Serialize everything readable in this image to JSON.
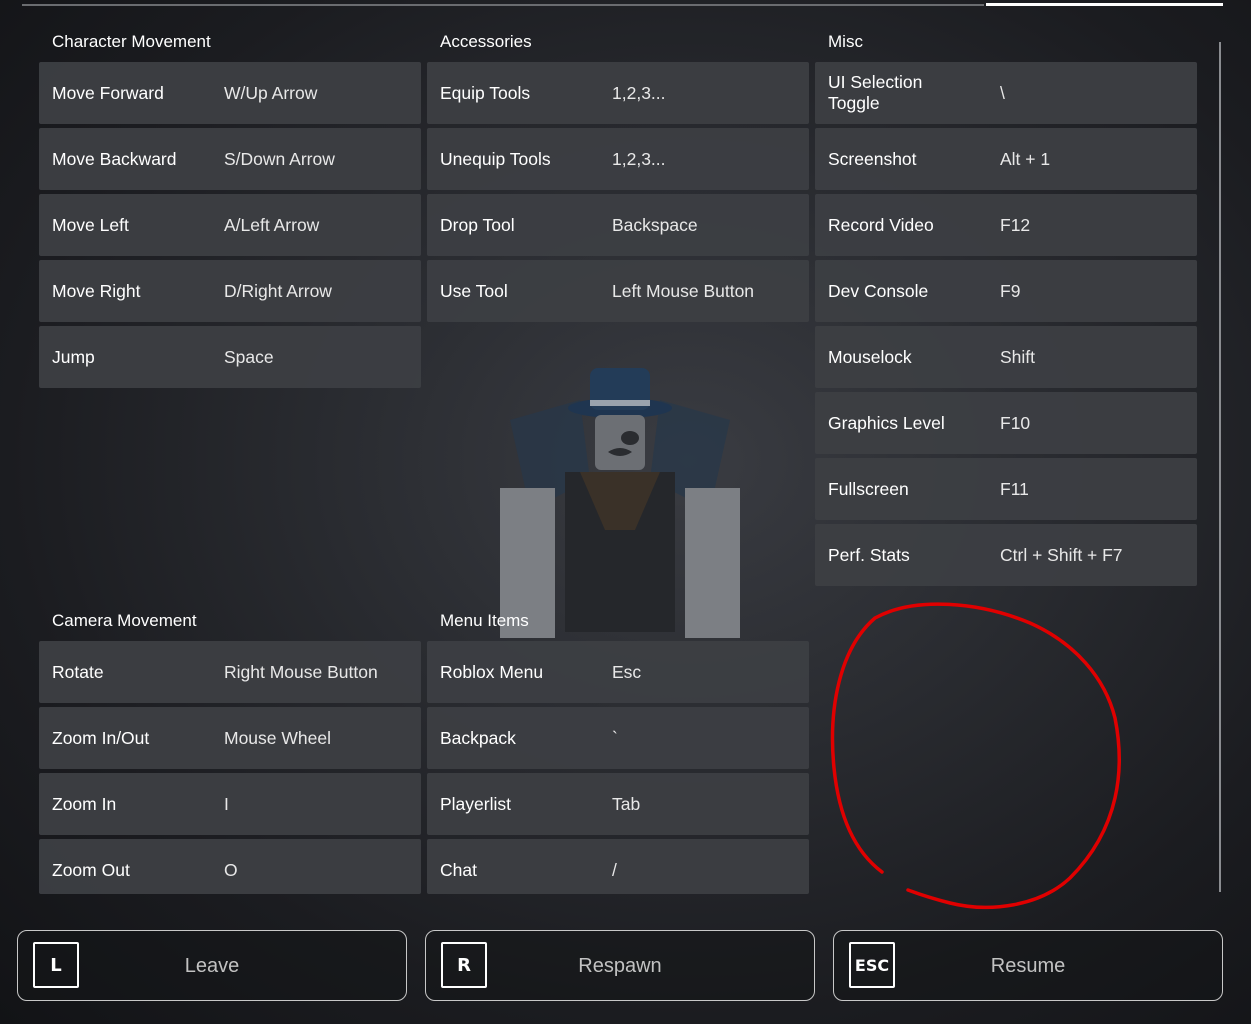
{
  "sections": {
    "character_movement": {
      "title": "Character Movement",
      "rows": [
        {
          "action": "Move Forward",
          "key": "W/Up Arrow"
        },
        {
          "action": "Move Backward",
          "key": "S/Down Arrow"
        },
        {
          "action": "Move Left",
          "key": "A/Left Arrow"
        },
        {
          "action": "Move Right",
          "key": "D/Right Arrow"
        },
        {
          "action": "Jump",
          "key": "Space"
        }
      ]
    },
    "accessories": {
      "title": "Accessories",
      "rows": [
        {
          "action": "Equip Tools",
          "key": "1,2,3..."
        },
        {
          "action": "Unequip Tools",
          "key": "1,2,3..."
        },
        {
          "action": "Drop Tool",
          "key": "Backspace"
        },
        {
          "action": "Use Tool",
          "key": "Left Mouse Button"
        }
      ]
    },
    "misc": {
      "title": "Misc",
      "rows": [
        {
          "action": "UI Selection Toggle",
          "key": "\\"
        },
        {
          "action": "Screenshot",
          "key": "Alt + 1"
        },
        {
          "action": "Record Video",
          "key": "F12"
        },
        {
          "action": "Dev Console",
          "key": "F9"
        },
        {
          "action": "Mouselock",
          "key": "Shift"
        },
        {
          "action": "Graphics Level",
          "key": "F10"
        },
        {
          "action": "Fullscreen",
          "key": "F11"
        },
        {
          "action": "Perf. Stats",
          "key": "Ctrl + Shift + F7"
        }
      ]
    },
    "camera_movement": {
      "title": "Camera Movement",
      "rows": [
        {
          "action": "Rotate",
          "key": "Right Mouse Button"
        },
        {
          "action": "Zoom In/Out",
          "key": "Mouse Wheel"
        },
        {
          "action": "Zoom In",
          "key": "I"
        },
        {
          "action": "Zoom Out",
          "key": "O"
        }
      ]
    },
    "menu_items": {
      "title": "Menu Items",
      "rows": [
        {
          "action": "Roblox Menu",
          "key": "Esc"
        },
        {
          "action": "Backpack",
          "key": "`"
        },
        {
          "action": "Playerlist",
          "key": "Tab"
        },
        {
          "action": "Chat",
          "key": "/"
        }
      ]
    }
  },
  "buttons": {
    "leave": {
      "key": "L",
      "label": "Leave"
    },
    "respawn": {
      "key": "R",
      "label": "Respawn"
    },
    "resume": {
      "key": "ESC",
      "label": "Resume"
    }
  },
  "colors": {
    "row_background": "#3c3e43",
    "annotation": "#e00000",
    "button_border": "#c8c8c8"
  }
}
